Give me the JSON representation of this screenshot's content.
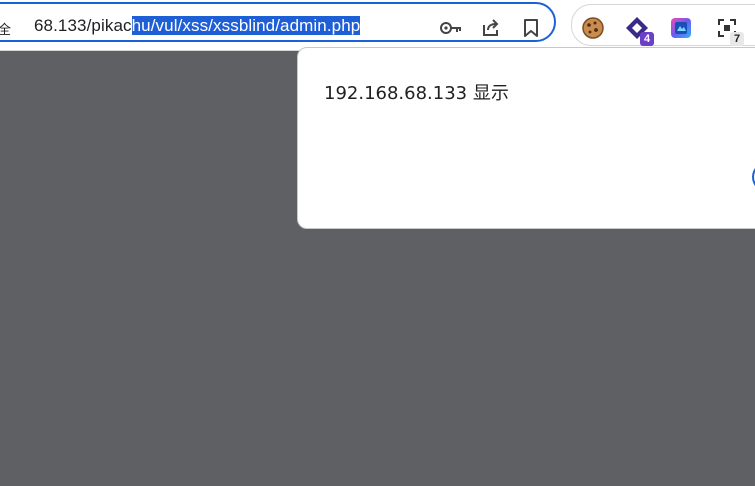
{
  "browser": {
    "security_label": "不安全",
    "url_prefix": "68.133/pikac",
    "url_selected": "hu/vul/xss/xssblind/admin.php",
    "icons": [
      "password-key-icon",
      "share-icon",
      "bookmark-icon"
    ]
  },
  "extensions": [
    {
      "name": "cookie-extension-icon",
      "badge": ""
    },
    {
      "name": "purple-diamond-extension-icon",
      "badge": "4"
    },
    {
      "name": "colorful-square-extension-icon",
      "badge": ""
    },
    {
      "name": "qr-scan-extension-icon",
      "badge": "7"
    }
  ],
  "dialog": {
    "title": "192.168.68.133 显示"
  },
  "colors": {
    "overlay": "#5f6063",
    "accent": "#1a63d6",
    "badge": "#6b3fc8"
  }
}
